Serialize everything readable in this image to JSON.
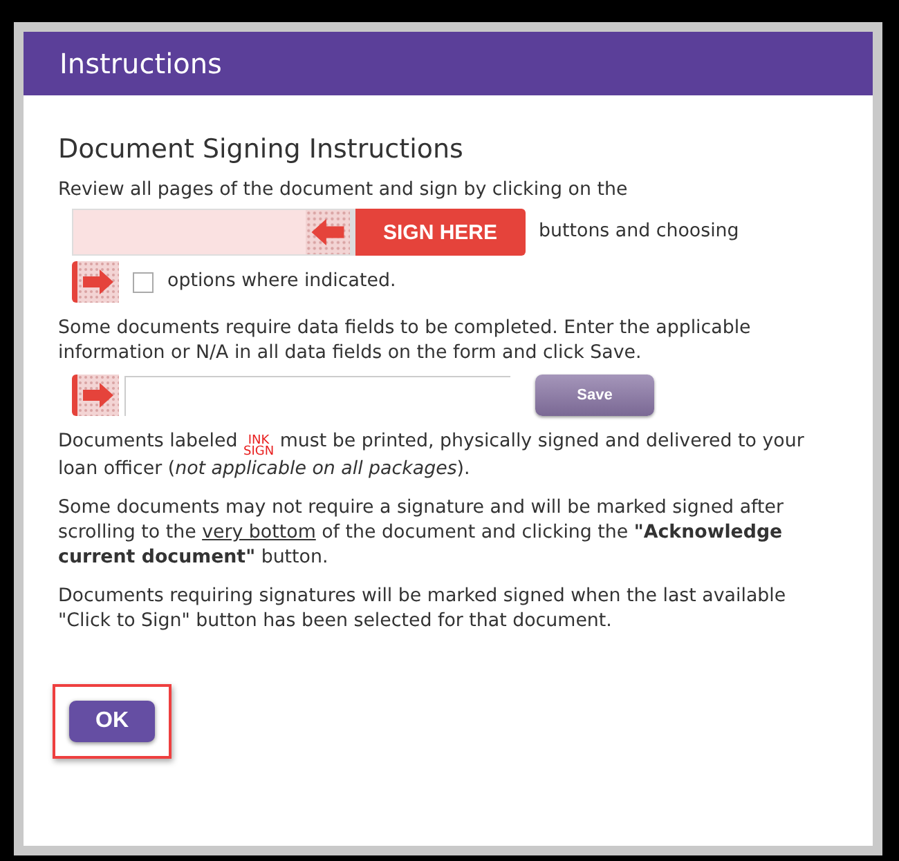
{
  "dialog": {
    "title": "Instructions",
    "heading": "Document Signing Instructions",
    "intro": "Review all pages of the document and sign by clicking on the",
    "sign_here": {
      "label": "SIGN HERE",
      "after": "buttons and choosing"
    },
    "option_row": {
      "checked": false,
      "label": "options where indicated."
    },
    "data_fields_text": "Some documents require data fields to be completed. Enter the applicable information or N/A in all data fields on the form and click Save.",
    "save_row": {
      "button": "Save"
    },
    "ink_text": {
      "before": "Documents labeled",
      "ink_top": "INK",
      "ink_bottom": "SIGN",
      "after": "must be printed, physically signed and delivered to your loan officer (*not applicable on all packages*)."
    },
    "acknowledge_text": [
      {
        "text": "Some documents may not require a signature and will be marked signed after scrolling to the ",
        "underline": false
      },
      {
        "text": "very bottom",
        "underline": true
      },
      {
        "text": " of the document and clicking the **\"Acknowledge current document\"** button.",
        "underline": false
      }
    ],
    "last_text": "Documents requiring signatures will be marked signed when the last available \"Click to Sign\" button has been selected for that document.",
    "ok_button": {
      "label": "OK",
      "highlighted": true
    }
  }
}
